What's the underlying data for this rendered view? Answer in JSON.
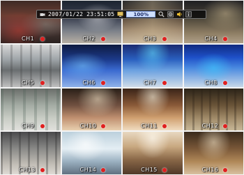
{
  "status_bar": {
    "datetime": "2007/01/22  23:51:05",
    "zoom": "100%",
    "icons": [
      "monitor-icon",
      "search-icon",
      "gear-icon",
      "speaker-icon",
      "info-icon"
    ]
  },
  "accent": {
    "rec": "#e02020",
    "zoom_bg": "#cfe0ff"
  },
  "cameras": [
    {
      "label": "CH1",
      "rec": true
    },
    {
      "label": "CH2",
      "rec": true
    },
    {
      "label": "CH3",
      "rec": true
    },
    {
      "label": "CH4",
      "rec": true
    },
    {
      "label": "CH5",
      "rec": true
    },
    {
      "label": "CH6",
      "rec": true
    },
    {
      "label": "CH7",
      "rec": true
    },
    {
      "label": "CH8",
      "rec": true
    },
    {
      "label": "CH9",
      "rec": true
    },
    {
      "label": "CH10",
      "rec": true
    },
    {
      "label": "CH11",
      "rec": true
    },
    {
      "label": "CH12",
      "rec": true
    },
    {
      "label": "CH13",
      "rec": true
    },
    {
      "label": "CH14",
      "rec": true
    },
    {
      "label": "CH15",
      "rec": true
    },
    {
      "label": "CH16",
      "rec": true
    }
  ]
}
